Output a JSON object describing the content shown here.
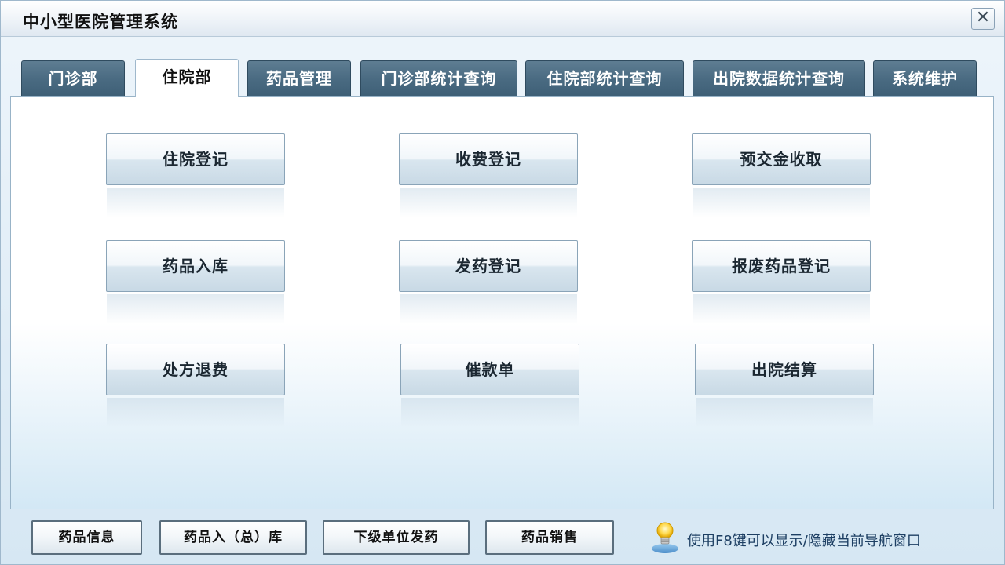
{
  "window": {
    "title": "中小型医院管理系统",
    "close_glyph": "✕"
  },
  "tabs": [
    {
      "label": "门诊部"
    },
    {
      "label": "住院部"
    },
    {
      "label": "药品管理"
    },
    {
      "label": "门诊部统计查询"
    },
    {
      "label": "住院部统计查询"
    },
    {
      "label": "出院数据统计查询"
    },
    {
      "label": "系统维护"
    }
  ],
  "active_tab": "住院部",
  "functions": [
    {
      "label": "住院登记"
    },
    {
      "label": "收费登记"
    },
    {
      "label": "预交金收取"
    },
    {
      "label": "药品入库"
    },
    {
      "label": "发药登记"
    },
    {
      "label": "报废药品登记"
    },
    {
      "label": "处方退费"
    },
    {
      "label": "催款单"
    },
    {
      "label": "出院结算"
    }
  ],
  "bottom_buttons": [
    {
      "label": "药品信息"
    },
    {
      "label": "药品入（总）库"
    },
    {
      "label": "下级单位发药"
    },
    {
      "label": "药品销售"
    }
  ],
  "hint": {
    "text": "使用F8键可以显示/隐藏当前导航窗口",
    "icon": "lightbulb-icon"
  }
}
